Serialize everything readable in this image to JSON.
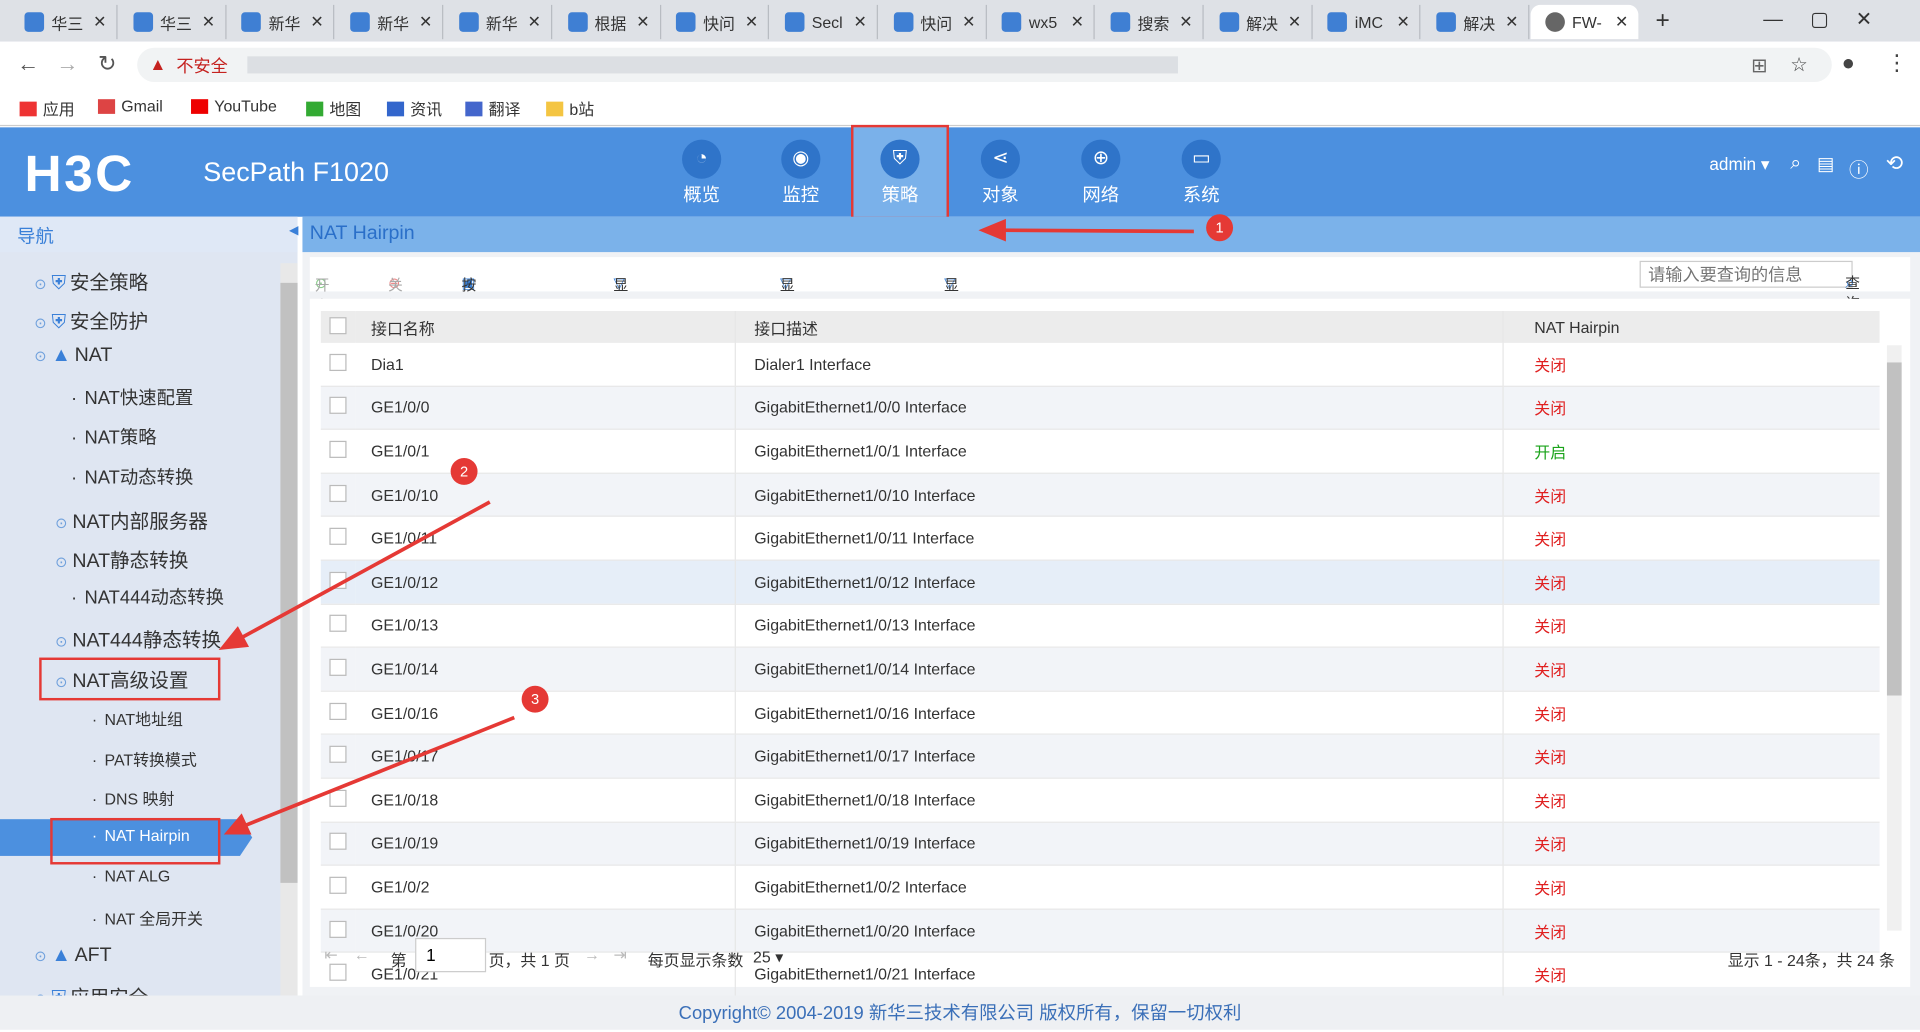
{
  "browser": {
    "tabs": [
      "华三",
      "华三",
      "新华",
      "新华",
      "新华",
      "根据",
      "快问",
      "Secl",
      "快问",
      "wx5",
      "搜索",
      "解决",
      "iMC",
      "解决",
      "FW-"
    ],
    "security_label": "不安全",
    "bookmarks": [
      "应用",
      "Gmail",
      "YouTube",
      "地图",
      "资讯",
      "翻译",
      "b站"
    ]
  },
  "header": {
    "logo": "H3C",
    "product": "SecPath F1020",
    "user": "admin",
    "nav": [
      "概览",
      "监控",
      "策略",
      "对象",
      "网络",
      "系统"
    ]
  },
  "breadcrumb": "NAT Hairpin",
  "sidebar": {
    "title": "导航",
    "items": [
      "安全策略",
      "安全防护",
      "NAT",
      "NAT快速配置",
      "NAT策略",
      "NAT动态转换",
      "NAT内部服务器",
      "NAT静态转换",
      "NAT444动态转换",
      "NAT444静态转换",
      "NAT高级设置",
      "NAT地址组",
      "PAT转换模式",
      "DNS 映射",
      "NAT Hairpin",
      "NAT ALG",
      "NAT 全局开关",
      "AFT",
      "应用安全"
    ]
  },
  "toolbar": {
    "enable": "开启",
    "disable": "关闭",
    "export": "按页面显示导出",
    "show_enabled": "显示已启用的接口",
    "show_disabled": "显示未启用的接口",
    "show_all": "显示所有接口",
    "search_placeholder": "请输入要查询的信息",
    "search": "查询"
  },
  "table": {
    "headers": [
      "接口名称",
      "接口描述",
      "NAT Hairpin"
    ],
    "rows": [
      [
        "Dia1",
        "Dialer1 Interface",
        "关闭"
      ],
      [
        "GE1/0/0",
        "GigabitEthernet1/0/0 Interface",
        "关闭"
      ],
      [
        "GE1/0/1",
        "GigabitEthernet1/0/1 Interface",
        "开启"
      ],
      [
        "GE1/0/10",
        "GigabitEthernet1/0/10 Interface",
        "关闭"
      ],
      [
        "GE1/0/11",
        "GigabitEthernet1/0/11 Interface",
        "关闭"
      ],
      [
        "GE1/0/12",
        "GigabitEthernet1/0/12 Interface",
        "关闭"
      ],
      [
        "GE1/0/13",
        "GigabitEthernet1/0/13 Interface",
        "关闭"
      ],
      [
        "GE1/0/14",
        "GigabitEthernet1/0/14 Interface",
        "关闭"
      ],
      [
        "GE1/0/16",
        "GigabitEthernet1/0/16 Interface",
        "关闭"
      ],
      [
        "GE1/0/17",
        "GigabitEthernet1/0/17 Interface",
        "关闭"
      ],
      [
        "GE1/0/18",
        "GigabitEthernet1/0/18 Interface",
        "关闭"
      ],
      [
        "GE1/0/19",
        "GigabitEthernet1/0/19 Interface",
        "关闭"
      ],
      [
        "GE1/0/2",
        "GigabitEthernet1/0/2 Interface",
        "关闭"
      ],
      [
        "GE1/0/20",
        "GigabitEthernet1/0/20 Interface",
        "关闭"
      ],
      [
        "GE1/0/21",
        "GigabitEthernet1/0/21 Interface",
        "关闭"
      ]
    ]
  },
  "pager": {
    "page_prefix": "第",
    "page": "1",
    "page_suffix": "页，共 1 页",
    "per_page_label": "每页显示条数",
    "per_page": "25",
    "summary": "显示 1 - 24条，共 24 条"
  },
  "footer": "Copyright© 2004-2019 新华三技术有限公司 版权所有，保留一切权利",
  "annotations": [
    "1",
    "2",
    "3"
  ],
  "colors": {
    "on": "#1aa31a",
    "off": "#e02020",
    "header": "#4c90df"
  }
}
